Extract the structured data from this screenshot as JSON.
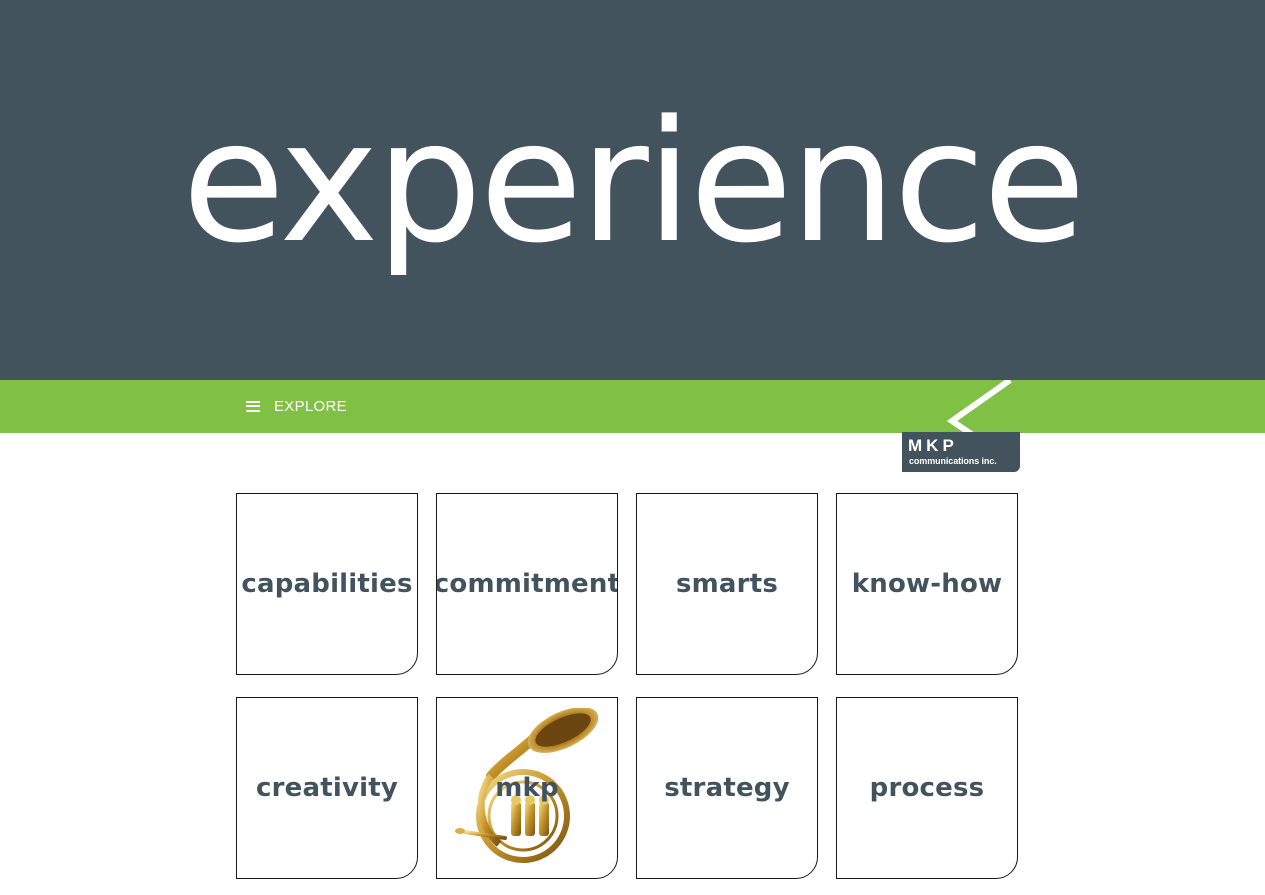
{
  "hero": {
    "title": "experience"
  },
  "nav": {
    "explore_label": "EXPLORE",
    "menu_icon": "hamburger-icon"
  },
  "logo": {
    "name": "MKP",
    "subtitle": "communications inc."
  },
  "tiles": [
    {
      "label": "capabilities"
    },
    {
      "label": "commitment"
    },
    {
      "label": "smarts"
    },
    {
      "label": "know-how"
    },
    {
      "label": "creativity"
    },
    {
      "label": "mkp",
      "icon": "french-horn-icon"
    },
    {
      "label": "strategy"
    },
    {
      "label": "process"
    }
  ],
  "colors": {
    "hero_bg": "#43535e",
    "nav_bg": "#80c145",
    "tile_text": "#43535e",
    "tile_border": "#1a1a1a"
  }
}
